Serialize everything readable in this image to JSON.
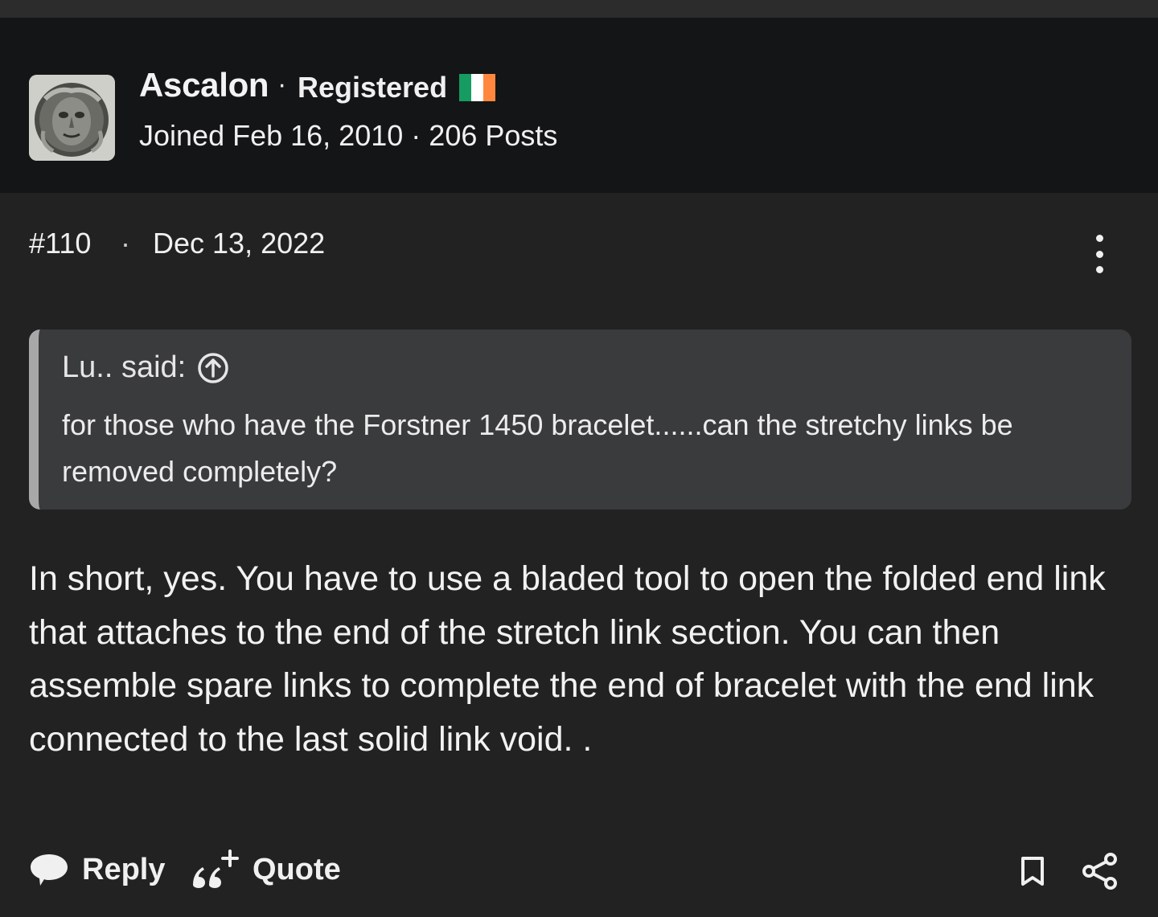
{
  "author": {
    "username": "Ascalon",
    "separator": "·",
    "role": "Registered",
    "country_flag": "ireland-flag",
    "flag_colors": [
      "#169b62",
      "#ffffff",
      "#ff883e"
    ],
    "joined": "Joined Feb 16, 2010",
    "posts": "206 Posts",
    "meta_separator": "·"
  },
  "post": {
    "number": "#110",
    "separator": "·",
    "date": "Dec 13, 2022",
    "menu_icon": "more-vertical-icon"
  },
  "quote": {
    "author": "Lu.. said:",
    "jump_icon": "arrow-up-circle-icon",
    "text": "for those who have the Forstner 1450 bracelet......can the stretchy links be removed completely?"
  },
  "body": "In short, yes. You have to use a bladed tool to open the folded end link that attaches to the end of the stretch link section. You can then assemble spare links to complete the end of bracelet with the end link connected to the last solid link void. .",
  "actions": {
    "reply_label": "Reply",
    "quote_label": "Quote",
    "bookmark_icon": "bookmark-icon",
    "share_icon": "share-icon"
  },
  "colors": {
    "header_bg": "#141517",
    "page_bg": "#222223",
    "quote_bg": "#3a3b3d",
    "quote_border": "#a8a8a8"
  }
}
